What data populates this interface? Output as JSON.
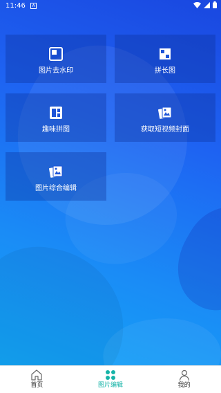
{
  "status_bar": {
    "time": "11:46",
    "notification": "A"
  },
  "tiles": [
    {
      "label": "图片去水印",
      "icon": "image-frame-icon"
    },
    {
      "label": "拼长图",
      "icon": "long-image-icon"
    },
    {
      "label": "趣味拼图",
      "icon": "collage-icon"
    },
    {
      "label": "获取短视频封面",
      "icon": "video-cover-icon"
    },
    {
      "label": "图片综合编辑",
      "icon": "photo-edit-icon"
    }
  ],
  "tabbar": {
    "items": [
      {
        "label": "首页",
        "icon": "home-icon",
        "active": false
      },
      {
        "label": "图片编辑",
        "icon": "clover-icon",
        "active": true
      },
      {
        "label": "我的",
        "icon": "user-icon",
        "active": false
      }
    ],
    "active_color": "#18b4a8"
  },
  "colors": {
    "background_start": "#1a47e0",
    "background_end": "#12a6f7"
  }
}
